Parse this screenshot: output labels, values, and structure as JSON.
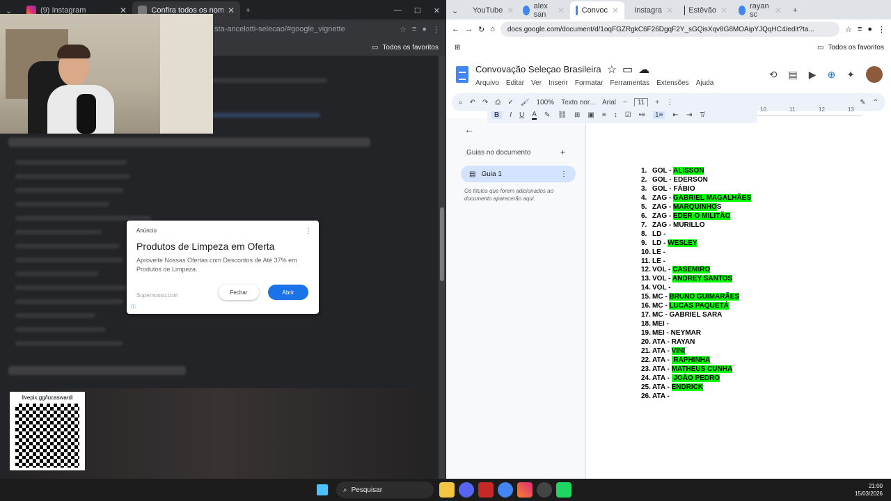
{
  "left_browser": {
    "tabs": [
      {
        "label": "(9) Instagram"
      },
      {
        "label": "Confira todos os nomes da pré"
      }
    ],
    "url": "sta-ancelotti-selecao/#google_vignette",
    "bookmarks_label": "Todos os favoritos",
    "ad": {
      "label": "Anúncio",
      "title": "Produtos de Limpeza em Oferta",
      "description": "Aproveite Nossas Ofertas com Descontos de Até 37% em Produtos de Limpeza.",
      "source": "Supernosso.com",
      "close_label": "Fechar",
      "open_label": "Abrir"
    },
    "qr_label": "livepix.gg/lucaswardi"
  },
  "right_browser": {
    "tabs": [
      {
        "label": "YouTube"
      },
      {
        "label": "alex san"
      },
      {
        "label": "Convoc"
      },
      {
        "label": "Instagra"
      },
      {
        "label": "Estêvão"
      },
      {
        "label": "rayan sc"
      }
    ],
    "url": "docs.google.com/document/d/1oqFGZRgkC6F26DgqF2Y_sGQisXqv8G8MOAipYJQqHC4/edit?ta...",
    "bookmarks_label": "Todos os favoritos",
    "doc_title": "Convovação Seleçao Brasileira",
    "menus": [
      "Arquivo",
      "Editar",
      "Ver",
      "Inserir",
      "Formatar",
      "Ferramentas",
      "Extensões",
      "Ajuda"
    ],
    "toolbar": {
      "zoom": "100%",
      "style": "Texto nor...",
      "font": "Arial",
      "size": "11"
    },
    "sidebar": {
      "heading": "Guias no documento",
      "tab_label": "Guia 1",
      "hint": "Os títulos que forem adicionados ao documento aparecerão aqui."
    },
    "ruler_labels": [
      "10",
      "11",
      "12",
      "13"
    ],
    "list": [
      {
        "num": "1.",
        "pos": "GOL - ",
        "name": "ALISSON",
        "hl": true
      },
      {
        "num": "2.",
        "pos": "GOL - ",
        "name": "EDERSON",
        "hl": false
      },
      {
        "num": "3.",
        "pos": "GOL - ",
        "name": "FÁBIO",
        "hl": false
      },
      {
        "num": "4.",
        "pos": "ZAG - ",
        "name": "GABRIEL MAGALHÃES",
        "hl": true
      },
      {
        "num": "5.",
        "pos": "ZAG - ",
        "name": "MARQUINHO",
        "hl": true,
        "suffix": "S"
      },
      {
        "num": "6.",
        "pos": "ZAG - ",
        "name": "EDER O MILITÃO",
        "hl": true
      },
      {
        "num": "7.",
        "pos": "ZAG - ",
        "name": "MURILLO",
        "hl": false
      },
      {
        "num": "8.",
        "pos": "LD - ",
        "name": "",
        "hl": false
      },
      {
        "num": "9.",
        "pos": "LD - ",
        "name": "WESLEY",
        "hl": true
      },
      {
        "num": "10.",
        "pos": "LE - ",
        "name": "",
        "hl": false
      },
      {
        "num": "11.",
        "pos": "LE - ",
        "name": "",
        "hl": false
      },
      {
        "num": "12.",
        "pos": "VOL - ",
        "name": "CASEMIRO",
        "hl": true
      },
      {
        "num": "13.",
        "pos": "VOL - ",
        "name": "ANDREY SANTOS",
        "hl": true
      },
      {
        "num": "14.",
        "pos": "VOL - ",
        "name": "",
        "hl": false
      },
      {
        "num": "15.",
        "pos": "MC - ",
        "name": "BRUNO GUIMARÃES",
        "hl": true
      },
      {
        "num": "16.",
        "pos": "MC - ",
        "name": "LUCAS PAQUETÁ",
        "hl": true
      },
      {
        "num": "17.",
        "pos": "MC - ",
        "name": "GABRIEL SARA",
        "hl": false
      },
      {
        "num": "18.",
        "pos": "MEI - ",
        "name": "",
        "hl": false
      },
      {
        "num": "19.",
        "pos": "MEI - ",
        "name": "NEYMAR",
        "hl": false
      },
      {
        "num": "20.",
        "pos": "ATA - ",
        "name": "RAYAN",
        "hl": false
      },
      {
        "num": "21.",
        "pos": "ATA - ",
        "name": "VINI",
        "hl": true
      },
      {
        "num": "22.",
        "pos": "ATA - ",
        "name": " RAPHINHA",
        "hl": true
      },
      {
        "num": "23.",
        "pos": "ATA - ",
        "name": "MATHEUS CUNHA",
        "hl": true
      },
      {
        "num": "24.",
        "pos": "ATA - ",
        "name": " JOÃO PEDRO",
        "hl": true
      },
      {
        "num": "25.",
        "pos": "ATA - ",
        "name": "ENDRICK",
        "hl": true
      },
      {
        "num": "26.",
        "pos": "ATA - ",
        "name": "",
        "hl": false
      }
    ]
  },
  "taskbar": {
    "search_label": "Pesquisar",
    "time": "21:00",
    "date": "15/03/2026"
  },
  "colors": {
    "highlight": "#00ff00",
    "docs_blue": "#4285f4",
    "accent": "#1a73e8"
  }
}
